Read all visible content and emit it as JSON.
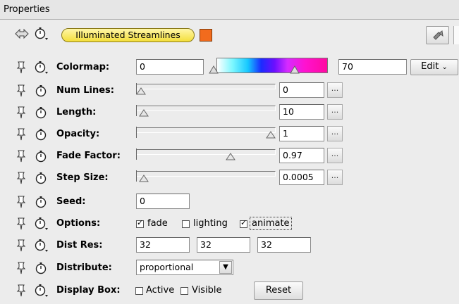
{
  "panel": {
    "title": "Properties"
  },
  "module": {
    "name": "Illuminated Streamlines",
    "swatch_color": "#f26b1d"
  },
  "colormap": {
    "label": "Colormap:",
    "min": "0",
    "max": "70",
    "edit_label": "Edit"
  },
  "num_lines": {
    "label": "Num Lines:",
    "value": "0",
    "fraction": 0.0,
    "dots": "..."
  },
  "length": {
    "label": "Length:",
    "value": "10",
    "fraction": 0.02,
    "dots": "..."
  },
  "opacity": {
    "label": "Opacity:",
    "value": "1",
    "fraction": 1.0,
    "dots": "..."
  },
  "fade_factor": {
    "label": "Fade Factor:",
    "value": "0.97",
    "fraction": 0.69,
    "dots": "..."
  },
  "step_size": {
    "label": "Step Size:",
    "value": "0.0005",
    "fraction": 0.02,
    "dots": "..."
  },
  "seed": {
    "label": "Seed:",
    "value": "0"
  },
  "options": {
    "label": "Options:",
    "items": [
      {
        "label": "fade",
        "checked": true
      },
      {
        "label": "lighting",
        "checked": false
      },
      {
        "label": "animate",
        "checked": true
      }
    ]
  },
  "dist_res": {
    "label": "Dist Res:",
    "values": [
      "32",
      "32",
      "32"
    ]
  },
  "distribute": {
    "label": "Distribute:",
    "selected": "proportional"
  },
  "display_box": {
    "label": "Display Box:",
    "active_label": "Active",
    "active_checked": false,
    "visible_label": "Visible",
    "visible_checked": false,
    "reset_label": "Reset"
  }
}
